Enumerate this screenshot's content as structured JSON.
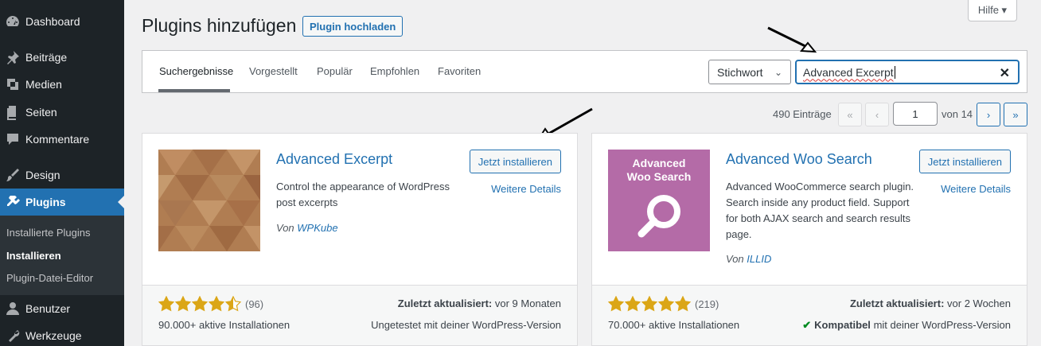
{
  "sidebar": {
    "items": [
      {
        "label": "Dashboard",
        "icon": "dashboard-icon"
      },
      {
        "label": "Beiträge",
        "icon": "pin-icon"
      },
      {
        "label": "Medien",
        "icon": "media-icon"
      },
      {
        "label": "Seiten",
        "icon": "pages-icon"
      },
      {
        "label": "Kommentare",
        "icon": "comment-icon"
      },
      {
        "label": "Design",
        "icon": "brush-icon"
      },
      {
        "label": "Plugins",
        "icon": "plugin-icon"
      },
      {
        "label": "Benutzer",
        "icon": "user-icon"
      },
      {
        "label": "Werkzeuge",
        "icon": "wrench-icon"
      }
    ],
    "submenu": [
      "Installierte Plugins",
      "Installieren",
      "Plugin-Datei-Editor"
    ]
  },
  "header": {
    "title": "Plugins hinzufügen",
    "upload_label": "Plugin hochladen",
    "help_label": "Hilfe ▾"
  },
  "filter": {
    "tabs": [
      "Suchergebnisse",
      "Vorgestellt",
      "Populär",
      "Empfohlen",
      "Favoriten"
    ],
    "type_value": "Stichwort",
    "search_value": "Advanced Excerpt",
    "clear_icon": "close-icon"
  },
  "pagination": {
    "count": "490 Einträge",
    "first": "«",
    "prev": "‹",
    "page": "1",
    "of": "von 14",
    "next": "›",
    "last": "»"
  },
  "plugins": [
    {
      "name": "Advanced Excerpt",
      "description": "Control the appearance of WordPress post excerpts",
      "by": "Von",
      "author": "WPKube",
      "install_label": "Jetzt installieren",
      "details_label": "Weitere Details",
      "rating": 4.5,
      "rating_count": "(96)",
      "installs": "90.000+ aktive Installationen",
      "updated_label": "Zuletzt aktualisiert:",
      "updated_value": "vor 9 Monaten",
      "compat_text": "Ungetestet mit deiner WordPress-Version"
    },
    {
      "name": "Advanced Woo Search",
      "thumb_text": "Advanced Woo Search",
      "description": "Advanced WooCommerce search plugin. Search inside any product field. Support for both AJAX search and search results page.",
      "by": "Von",
      "author": "ILLID",
      "install_label": "Jetzt installieren",
      "details_label": "Weitere Details",
      "rating": 5,
      "rating_count": "(219)",
      "installs": "70.000+ aktive Installationen",
      "updated_label": "Zuletzt aktualisiert:",
      "updated_value": "vor 2 Wochen",
      "compat_strong": "Kompatibel",
      "compat_text": "mit deiner WordPress-Version"
    }
  ],
  "colors": {
    "sidebar_bg": "#1d2327",
    "accent": "#2271b1",
    "star": "#dba617",
    "thumb2_bg": "#b46ba7"
  }
}
